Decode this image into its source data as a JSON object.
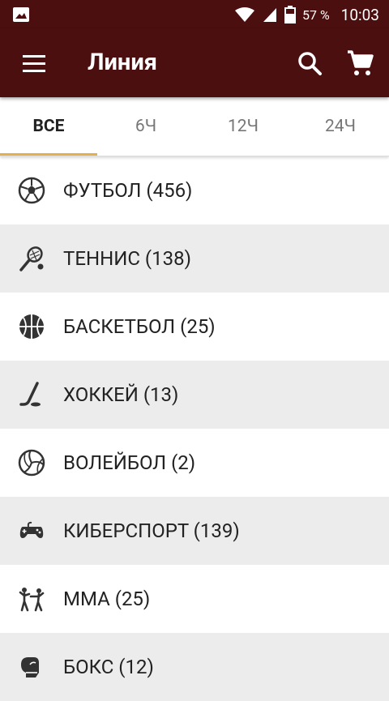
{
  "status_bar": {
    "battery": "57 %",
    "time": "10:03"
  },
  "app_bar": {
    "title": "Линия"
  },
  "tabs": [
    {
      "label": "ВСЕ",
      "active": true
    },
    {
      "label": "6Ч"
    },
    {
      "label": "12Ч"
    },
    {
      "label": "24Ч"
    }
  ],
  "sports": [
    {
      "label": "ФУТБОЛ (456)",
      "icon": "soccer-ball-icon"
    },
    {
      "label": "ТЕННИС (138)",
      "icon": "tennis-racket-icon"
    },
    {
      "label": "БАСКЕТБОЛ (25)",
      "icon": "basketball-icon"
    },
    {
      "label": "ХОККЕЙ (13)",
      "icon": "hockey-stick-icon"
    },
    {
      "label": "ВОЛЕЙБОЛ (2)",
      "icon": "volleyball-icon"
    },
    {
      "label": "КИБЕРСПОРТ (139)",
      "icon": "gamepad-icon"
    },
    {
      "label": "ММА (25)",
      "icon": "mma-fighter-icon"
    },
    {
      "label": "БОКС (12)",
      "icon": "boxing-glove-icon"
    }
  ],
  "colors": {
    "bar": "#4b0f0f",
    "tab_indicator": "#e3b04b",
    "row_alt": "#ececec"
  }
}
